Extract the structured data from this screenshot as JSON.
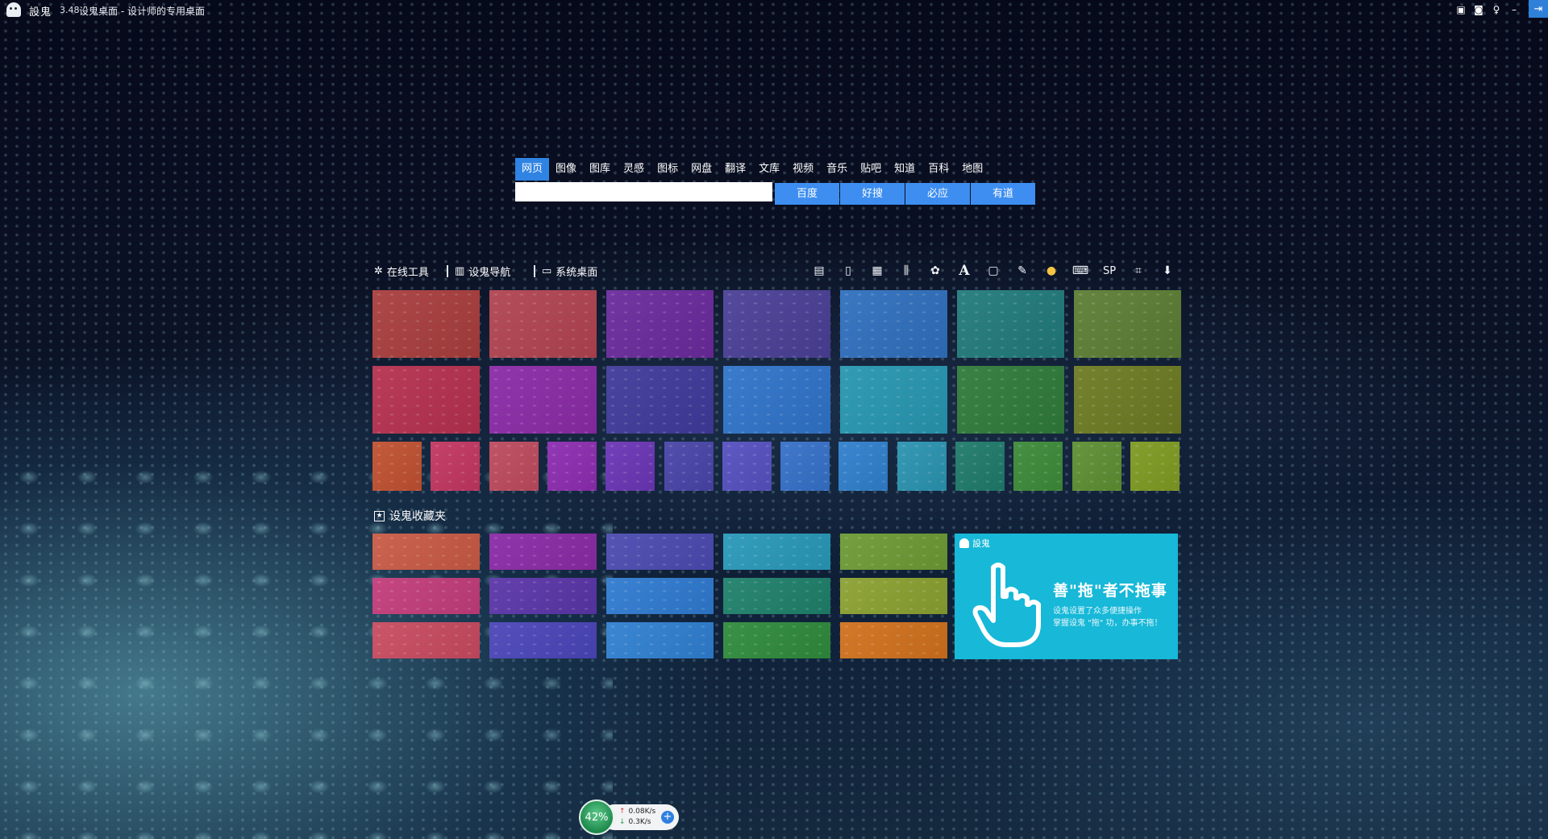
{
  "titlebar": {
    "brand": "設鬼",
    "version": "3.48",
    "title": "设鬼桌面 - 设计师的专用桌面"
  },
  "search": {
    "tabs": [
      "网页",
      "图像",
      "图库",
      "灵感",
      "图标",
      "网盘",
      "翻译",
      "文库",
      "视频",
      "音乐",
      "贴吧",
      "知道",
      "百科",
      "地图"
    ],
    "active_tab": "网页",
    "input_value": "",
    "engines": [
      "百度",
      "好搜",
      "必应",
      "有道"
    ],
    "accent": "#2f83e3"
  },
  "sections": {
    "online_tools": "在线工具",
    "nav": "设鬼导航",
    "desktop": "系统桌面",
    "toolbar_icons": [
      "notepad-icon",
      "memo-icon",
      "calculator-icon",
      "equalizer-icon",
      "palette-icon",
      "font-icon",
      "note-icon",
      "color-picker-icon",
      "color-wheel-icon",
      "keyboard-icon",
      "sp-icon",
      "crop-icon",
      "download-icon"
    ],
    "sp_label": "SP",
    "font_label": "A"
  },
  "tiles": {
    "row1_colors": [
      "#a83d3d",
      "#b04350",
      "#6a2a9c",
      "#4a3f96",
      "#2f6fbd",
      "#217a7a",
      "#5b7d34"
    ],
    "row2_colors": [
      "#b5304f",
      "#8a2aa6",
      "#3f3a9a",
      "#2f73c9",
      "#2696b0",
      "#2f7a3a",
      "#6c7a22"
    ],
    "row3_colors": [
      "#c05030",
      "#c23660",
      "#bd4a5e",
      "#8c2cb0",
      "#6a35b5",
      "#4844a8",
      "#5550c0",
      "#3570c8",
      "#2f7fcc",
      "#2a93b0",
      "#1e7a6a",
      "#3c8a38",
      "#5c8f32",
      "#7e9a22"
    ]
  },
  "favorites": {
    "label": "设鬼收藏夹",
    "colors": [
      [
        "#c85a45",
        "#8a2aa6",
        "#4b4ab0",
        "#2898b8",
        "#6c9a34"
      ],
      [
        "#c23c7a",
        "#5a35a8",
        "#2f7ad0",
        "#1e806a",
        "#8aa030"
      ],
      [
        "#c84a60",
        "#4a45b8",
        "#2f7fd0",
        "#2f8a3c",
        "#d0701c"
      ]
    ]
  },
  "promo": {
    "brand": "設鬼",
    "title": "善\"拖\"者不拖事",
    "line1": "设鬼设置了众多便捷操作",
    "line2": "掌握设鬼 \"拖\" 功，办事不拖！",
    "color": "#17b8d8"
  },
  "net": {
    "percent": "42%",
    "up": "0.08K/s",
    "down": "0.3K/s"
  }
}
